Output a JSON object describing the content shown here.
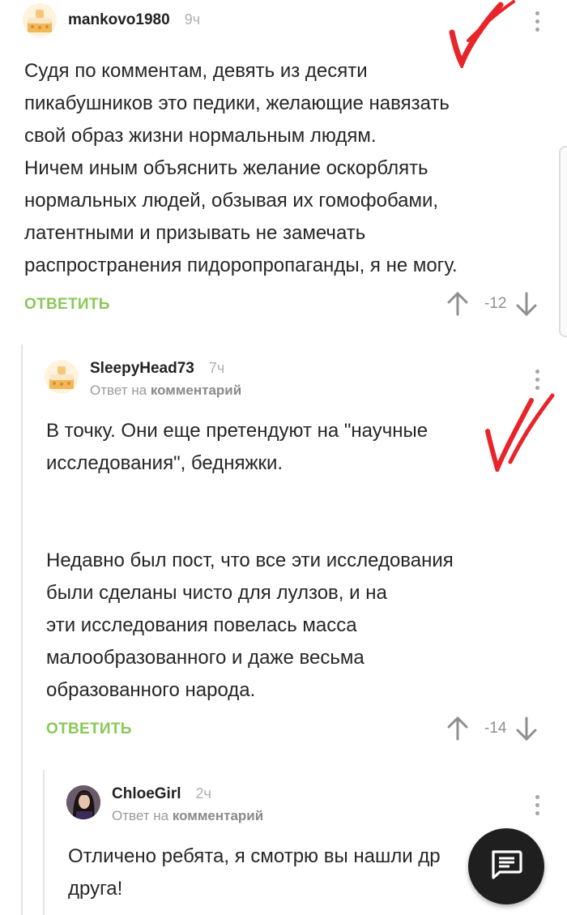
{
  "comments": [
    {
      "author": "mankovo1980",
      "time": "9ч",
      "text": "Судя по комментам, девять из десяти\nпикабушников это педики, желающие навязать\nсвой образ жизни нормальным людям.\nНичем иным объяснить желание оскорблять\nнормальных людей, обзывая их гомофобами,\nлатентными и призывать не замечать\nраспространения пидоропропаганды, я не могу.",
      "reply_label": "ОТВЕТИТЬ",
      "rating": "-12",
      "avatar_icon": "cake-avatar-icon"
    },
    {
      "author": "SleepyHead73",
      "time": "7ч",
      "reply_prefix": "Ответ на",
      "reply_target": "комментарий",
      "text": "В точку. Они еще претендуют на \"научные\nисследования\", бедняжки.\n\n\nНедавно был пост, что все эти исследования\nбыли сделаны чисто для лулзов, и на\nэти исследования повелась масса\nмалообразованного и даже весьма\nобразованного народа.",
      "reply_label": "ОТВЕТИТЬ",
      "rating": "-14",
      "avatar_icon": "cake-avatar-icon"
    },
    {
      "author": "ChloeGirl",
      "time": "2ч",
      "reply_prefix": "Ответ на",
      "reply_target": "комментарий",
      "text": "Отличено ребята, я смотрю вы нашли др\nдруга!",
      "avatar_icon": "girl-avatar-icon"
    }
  ],
  "fab_icon": "message-icon",
  "colors": {
    "accent_green": "#8ac858",
    "mark_red": "#e8232a",
    "fab_bg": "#1f1f1f"
  }
}
